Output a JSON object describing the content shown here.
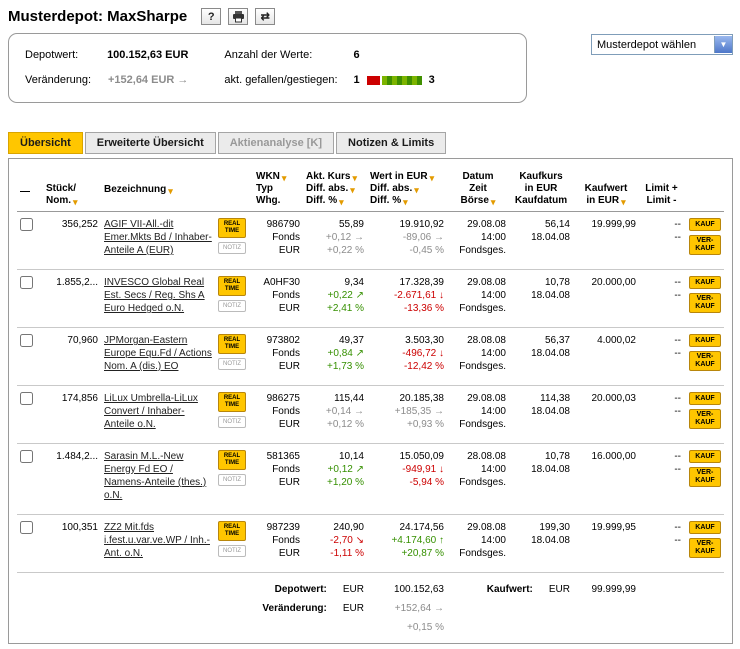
{
  "header": {
    "title": "Musterdepot: MaxSharpe",
    "help_icon": "?",
    "swap_icon": "⇄",
    "depot_select_label": "Musterdepot wählen"
  },
  "summary": {
    "depotwert_label": "Depotwert:",
    "depotwert_value": "100.152,63 EUR",
    "veraenderung_label": "Veränderung:",
    "veraenderung_value": "+152,64 EUR",
    "veraenderung_arrow": "→",
    "anzahl_label": "Anzahl der Werte:",
    "anzahl_value": "6",
    "updown_label": "akt. gefallen/gestiegen:",
    "fallen_count": "1",
    "gestiegen_count": "3"
  },
  "tabs": [
    {
      "label": "Übersicht",
      "active": true
    },
    {
      "label": "Erweiterte Übersicht",
      "active": false
    },
    {
      "label": "Aktienanalyse [K]",
      "active": false,
      "disabled": true
    },
    {
      "label": "Notizen & Limits",
      "active": false
    }
  ],
  "buttons": {
    "realtime": [
      "REAL",
      "TIME"
    ],
    "notiz": "NOTIZ",
    "kauf": "KAUF",
    "verkauf": [
      "VER-",
      "KAUF"
    ]
  },
  "table": {
    "columns": [
      {
        "id": "select",
        "align": "left",
        "lines": [
          {
            "t": "—",
            "s": false
          }
        ]
      },
      {
        "id": "stueck",
        "align": "left",
        "lines": [
          {
            "t": "Stück/",
            "s": false
          },
          {
            "t": "Nom.",
            "s": true
          }
        ]
      },
      {
        "id": "name",
        "align": "left",
        "lines": [
          {
            "t": "Bezeichnung",
            "s": true,
            "active": true
          }
        ]
      },
      {
        "id": "tools",
        "align": "left",
        "lines": []
      },
      {
        "id": "wkn",
        "align": "left",
        "lines": [
          {
            "t": "WKN",
            "s": true
          },
          {
            "t": "Typ",
            "s": false
          },
          {
            "t": "Whg.",
            "s": false
          }
        ]
      },
      {
        "id": "kurs",
        "align": "left",
        "lines": [
          {
            "t": "Akt. Kurs",
            "s": true
          },
          {
            "t": "Diff. abs.",
            "s": true
          },
          {
            "t": "Diff. %",
            "s": true
          }
        ]
      },
      {
        "id": "wert",
        "align": "left",
        "lines": [
          {
            "t": "Wert in EUR",
            "s": true
          },
          {
            "t": "Diff. abs.",
            "s": true
          },
          {
            "t": "Diff. %",
            "s": true
          }
        ]
      },
      {
        "id": "datum",
        "align": "center",
        "lines": [
          {
            "t": "Datum",
            "s": false
          },
          {
            "t": "Zeit",
            "s": false
          },
          {
            "t": "Börse",
            "s": true
          }
        ]
      },
      {
        "id": "kaufkurs",
        "align": "center",
        "lines": [
          {
            "t": "Kaufkurs",
            "s": false
          },
          {
            "t": "in EUR",
            "s": false
          },
          {
            "t": "Kaufdatum",
            "s": false
          }
        ]
      },
      {
        "id": "kaufwert",
        "align": "center",
        "lines": [
          {
            "t": "Kaufwert",
            "s": false
          },
          {
            "t": "in EUR",
            "s": true
          }
        ]
      },
      {
        "id": "limit",
        "align": "center",
        "lines": [
          {
            "t": "Limit +",
            "s": false
          },
          {
            "t": "Limit -",
            "s": false
          }
        ]
      },
      {
        "id": "actions",
        "align": "left",
        "lines": []
      }
    ],
    "rows": [
      {
        "stueck": "356,252",
        "name": "AGIF VII-All.-dit Emer.Mkts Bd / Inhaber-Anteile A (EUR)",
        "wkn": "986790",
        "typ": "Fonds",
        "whg": "EUR",
        "kurs": "55,89",
        "kurs_diff": "+0,12",
        "kurs_arrow": "→",
        "kurs_trend": "flat",
        "kurs_pct": "+0,22 %",
        "wert": "19.910,92",
        "wert_diff": "-89,06",
        "wert_arrow": "→",
        "wert_trend": "flat",
        "wert_pct": "-0,45 %",
        "datum": "29.08.08",
        "zeit": "14:00",
        "boerse": "Fondsges.",
        "kaufkurs": "56,14",
        "kaufdatum": "18.04.08",
        "kaufwert": "19.999,99",
        "limit_plus": "--",
        "limit_minus": "--"
      },
      {
        "stueck": "1.855,2...",
        "name": "INVESCO Global Real Est. Secs / Reg. Shs A Euro Hedged o.N.",
        "wkn": "A0HF30",
        "typ": "Fonds",
        "whg": "EUR",
        "kurs": "9,34",
        "kurs_diff": "+0,22",
        "kurs_arrow": "↗",
        "kurs_trend": "up",
        "kurs_pct": "+2,41 %",
        "wert": "17.328,39",
        "wert_diff": "-2.671,61",
        "wert_arrow": "↓",
        "wert_trend": "down",
        "wert_pct": "-13,36 %",
        "datum": "29.08.08",
        "zeit": "14:00",
        "boerse": "Fondsges.",
        "kaufkurs": "10,78",
        "kaufdatum": "18.04.08",
        "kaufwert": "20.000,00",
        "limit_plus": "--",
        "limit_minus": "--"
      },
      {
        "stueck": "70,960",
        "name": "JPMorgan-Eastern Europe Equ.Fd / Actions Nom. A (dis.) EO",
        "wkn": "973802",
        "typ": "Fonds",
        "whg": "EUR",
        "kurs": "49,37",
        "kurs_diff": "+0,84",
        "kurs_arrow": "↗",
        "kurs_trend": "up",
        "kurs_pct": "+1,73 %",
        "wert": "3.503,30",
        "wert_diff": "-496,72",
        "wert_arrow": "↓",
        "wert_trend": "down",
        "wert_pct": "-12,42 %",
        "datum": "28.08.08",
        "zeit": "14:00",
        "boerse": "Fondsges.",
        "kaufkurs": "56,37",
        "kaufdatum": "18.04.08",
        "kaufwert": "4.000,02",
        "limit_plus": "--",
        "limit_minus": "--"
      },
      {
        "stueck": "174,856",
        "name": "LiLux Umbrella-LiLux Convert / Inhaber-Anteile o.N.",
        "wkn": "986275",
        "typ": "Fonds",
        "whg": "EUR",
        "kurs": "115,44",
        "kurs_diff": "+0,14",
        "kurs_arrow": "→",
        "kurs_trend": "flat",
        "kurs_pct": "+0,12 %",
        "wert": "20.185,38",
        "wert_diff": "+185,35",
        "wert_arrow": "→",
        "wert_trend": "flat",
        "wert_pct": "+0,93 %",
        "datum": "29.08.08",
        "zeit": "14:00",
        "boerse": "Fondsges.",
        "kaufkurs": "114,38",
        "kaufdatum": "18.04.08",
        "kaufwert": "20.000,03",
        "limit_plus": "--",
        "limit_minus": "--"
      },
      {
        "stueck": "1.484,2...",
        "name": "Sarasin M.L.-New Energy Fd EO / Namens-Anteile (thes.) o.N.",
        "wkn": "581365",
        "typ": "Fonds",
        "whg": "EUR",
        "kurs": "10,14",
        "kurs_diff": "+0,12",
        "kurs_arrow": "↗",
        "kurs_trend": "up",
        "kurs_pct": "+1,20 %",
        "wert": "15.050,09",
        "wert_diff": "-949,91",
        "wert_arrow": "↓",
        "wert_trend": "down",
        "wert_pct": "-5,94 %",
        "datum": "28.08.08",
        "zeit": "14:00",
        "boerse": "Fondsges.",
        "kaufkurs": "10,78",
        "kaufdatum": "18.04.08",
        "kaufwert": "16.000,00",
        "limit_plus": "--",
        "limit_minus": "--"
      },
      {
        "stueck": "100,351",
        "name": "ZZ2 Mit.fds i.fest.u.var.ve.WP / Inh.-Ant. o.N.",
        "wkn": "987239",
        "typ": "Fonds",
        "whg": "EUR",
        "kurs": "240,90",
        "kurs_diff": "-2,70",
        "kurs_arrow": "↘",
        "kurs_trend": "down",
        "kurs_pct": "-1,11 %",
        "wert": "24.174,56",
        "wert_diff": "+4.174,60",
        "wert_arrow": "↑",
        "wert_trend": "up",
        "wert_pct": "+20,87 %",
        "datum": "29.08.08",
        "zeit": "14:00",
        "boerse": "Fondsges.",
        "kaufkurs": "199,30",
        "kaufdatum": "18.04.08",
        "kaufwert": "19.999,95",
        "limit_plus": "--",
        "limit_minus": "--"
      }
    ]
  },
  "totals": {
    "depotwert_label": "Depotwert:",
    "depotwert_currency": "EUR",
    "depotwert_value": "100.152,63",
    "veraenderung_label": "Veränderung:",
    "veraenderung_currency": "EUR",
    "veraenderung_value": "+152,64",
    "veraenderung_arrow": "→",
    "veraenderung_pct": "+0,15 %",
    "kaufwert_label": "Kaufwert:",
    "kaufwert_currency": "EUR",
    "kaufwert_value": "99.999,99"
  }
}
